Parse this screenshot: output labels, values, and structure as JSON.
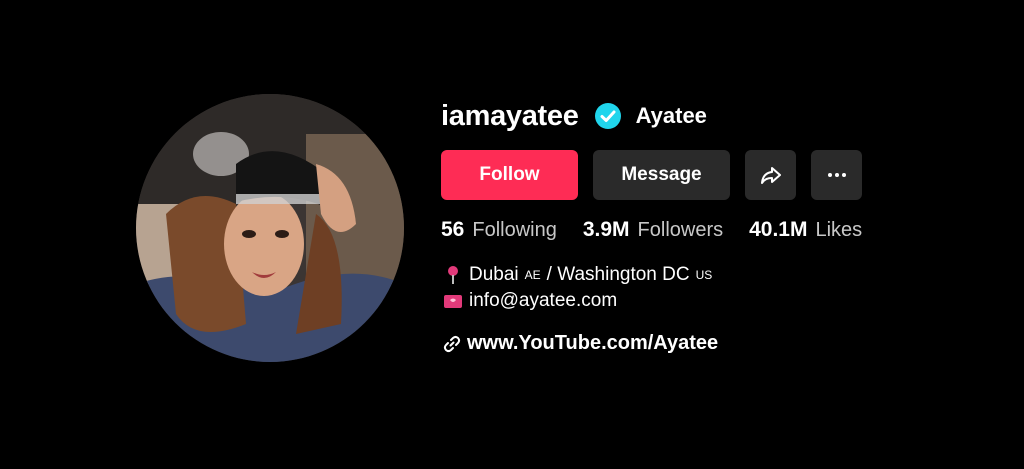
{
  "profile": {
    "username": "iamayatee",
    "display_name": "Ayatee"
  },
  "actions": {
    "follow_label": "Follow",
    "message_label": "Message"
  },
  "stats": {
    "following_count": "56",
    "following_label": "Following",
    "followers_count": "3.9M",
    "followers_label": "Followers",
    "likes_count": "40.1M",
    "likes_label": "Likes"
  },
  "bio": {
    "location_city1": "Dubai",
    "location_code1": "AE",
    "location_sep": "/ Washington DC",
    "location_code2": "US",
    "email": "info@ayatee.com"
  },
  "link": {
    "url_text": "www.YouTube.com/Ayatee"
  },
  "colors": {
    "background": "#000000",
    "follow_button": "#fe2c55",
    "secondary_button": "#2a2a2a",
    "verified_badge": "#20d5ec"
  },
  "icons": {
    "verified": "verified-badge-icon",
    "share": "share-arrow-icon",
    "more": "more-dots-icon",
    "location": "pin-icon",
    "email": "envelope-icon",
    "link": "link-icon"
  }
}
